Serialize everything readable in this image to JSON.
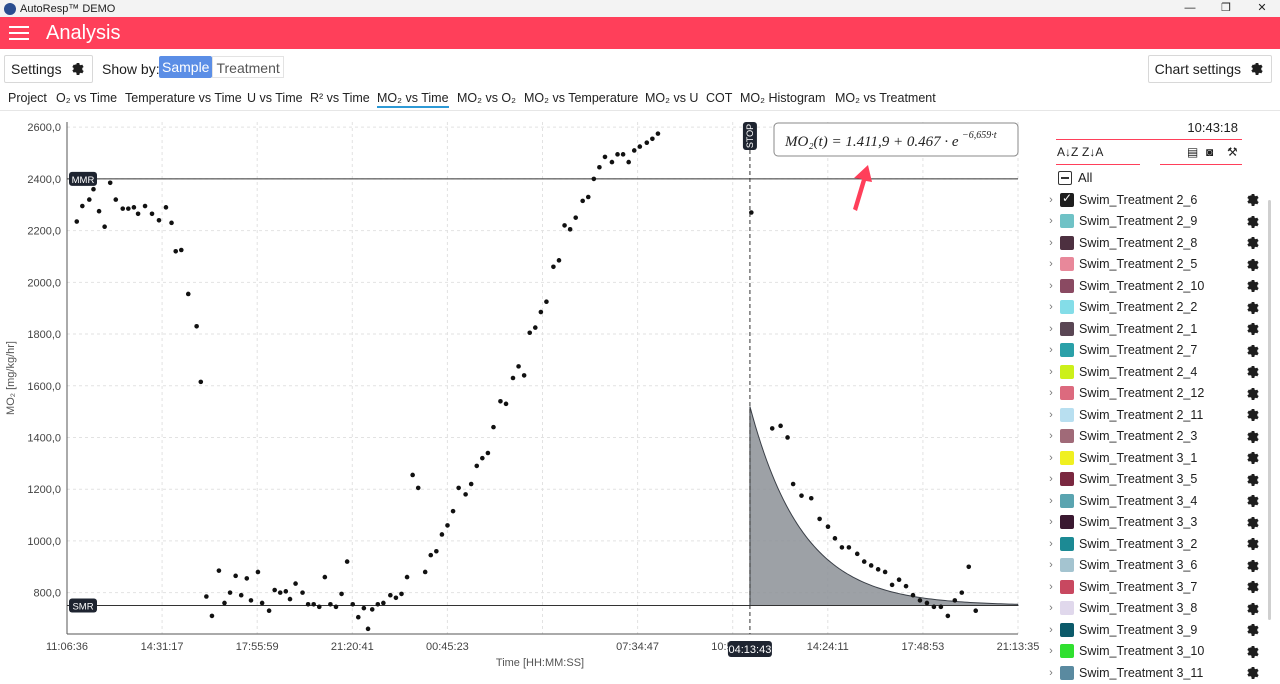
{
  "window": {
    "title": "AutoResp™ DEMO",
    "minimize": "—",
    "maximize": "❐",
    "close": "✕"
  },
  "header": {
    "title": "Analysis"
  },
  "toolbar": {
    "settings_label": "Settings",
    "showby_label": "Show by:",
    "sample_label": "Sample",
    "treatment_label": "Treatment",
    "chart_settings_label": "Chart settings"
  },
  "tabs": [
    "Project",
    "O₂ vs Time",
    "Temperature vs Time",
    "U vs Time",
    "R² vs Time",
    "MO₂ vs Time",
    "MO₂ vs O₂",
    "MO₂ vs Temperature",
    "MO₂ vs U",
    "COT",
    "MO₂ Histogram",
    "MO₂ vs Treatment"
  ],
  "active_tab": 5,
  "sidebar": {
    "time": "10:43:18",
    "all_label": "All",
    "items": [
      {
        "label": "Swim_Treatment 2_6",
        "color": "#1e1e1e",
        "checked": true
      },
      {
        "label": "Swim_Treatment 2_9",
        "color": "#6fc2c6"
      },
      {
        "label": "Swim_Treatment 2_8",
        "color": "#4d3040"
      },
      {
        "label": "Swim_Treatment 2_5",
        "color": "#e8889a"
      },
      {
        "label": "Swim_Treatment 2_10",
        "color": "#8a4a62"
      },
      {
        "label": "Swim_Treatment 2_2",
        "color": "#84dde8"
      },
      {
        "label": "Swim_Treatment 2_1",
        "color": "#5a4654"
      },
      {
        "label": "Swim_Treatment 2_7",
        "color": "#2aa0a8"
      },
      {
        "label": "Swim_Treatment 2_4",
        "color": "#ccf01a"
      },
      {
        "label": "Swim_Treatment 2_12",
        "color": "#dc6a7e"
      },
      {
        "label": "Swim_Treatment 2_11",
        "color": "#b8dff0"
      },
      {
        "label": "Swim_Treatment 2_3",
        "color": "#a06a78"
      },
      {
        "label": "Swim_Treatment 3_1",
        "color": "#f0f020"
      },
      {
        "label": "Swim_Treatment 3_5",
        "color": "#7a2840"
      },
      {
        "label": "Swim_Treatment 3_4",
        "color": "#5aa4b0"
      },
      {
        "label": "Swim_Treatment 3_3",
        "color": "#3a1830"
      },
      {
        "label": "Swim_Treatment 3_2",
        "color": "#1c8a94"
      },
      {
        "label": "Swim_Treatment 3_6",
        "color": "#a4c4d0"
      },
      {
        "label": "Swim_Treatment 3_7",
        "color": "#c84860"
      },
      {
        "label": "Swim_Treatment 3_8",
        "color": "#e0d8ec"
      },
      {
        "label": "Swim_Treatment 3_9",
        "color": "#0c5a6a"
      },
      {
        "label": "Swim_Treatment 3_10",
        "color": "#30e030"
      },
      {
        "label": "Swim_Treatment 3_11",
        "color": "#5a8aa0"
      }
    ]
  },
  "chart_data": {
    "type": "scatter",
    "ylabel": "MO₂ [mg/kg/hr]",
    "xlabel": "Time [HH:MM:SS]",
    "ylim": [
      640,
      2620
    ],
    "yticks": [
      800,
      1000,
      1200,
      1400,
      1600,
      1800,
      2000,
      2200,
      2400,
      2600
    ],
    "ytick_labels": [
      "800,0",
      "1000,0",
      "1200,0",
      "1400,0",
      "1600,0",
      "1800,0",
      "2000,0",
      "2200,0",
      "2400,0",
      "2600,0"
    ],
    "xtick_labels": [
      "11:06:36",
      "14:31:17",
      "17:55:59",
      "21:20:41",
      "00:45:23",
      "04:13:43",
      "07:34:47",
      "10:59:29",
      "14:24:11",
      "17:48:53",
      "21:13:35"
    ],
    "xlim_hours": [
      0,
      34.117
    ],
    "mmr": {
      "label": "MMR",
      "value": 2400
    },
    "smr": {
      "label": "SMR",
      "value": 750
    },
    "stop": {
      "label": "STOP",
      "x_hours": 24.5,
      "time_label": "04:13:43"
    },
    "equation": "MO₂(t) = 1.411,9 + 0.467 · e",
    "equation_exponent": "−6,659·t",
    "fit_start": 1520,
    "grid": true,
    "points": [
      [
        0.35,
        2235
      ],
      [
        0.55,
        2295
      ],
      [
        0.8,
        2320
      ],
      [
        0.95,
        2360
      ],
      [
        1.15,
        2275
      ],
      [
        1.35,
        2215
      ],
      [
        1.55,
        2385
      ],
      [
        1.75,
        2320
      ],
      [
        2.0,
        2285
      ],
      [
        2.2,
        2285
      ],
      [
        2.4,
        2290
      ],
      [
        2.55,
        2265
      ],
      [
        2.8,
        2295
      ],
      [
        3.05,
        2265
      ],
      [
        3.3,
        2240
      ],
      [
        3.55,
        2290
      ],
      [
        3.75,
        2230
      ],
      [
        3.9,
        2120
      ],
      [
        4.1,
        2125
      ],
      [
        4.35,
        1955
      ],
      [
        4.65,
        1830
      ],
      [
        4.8,
        1615
      ],
      [
        5.0,
        785
      ],
      [
        5.2,
        710
      ],
      [
        5.45,
        885
      ],
      [
        5.65,
        760
      ],
      [
        5.85,
        800
      ],
      [
        6.05,
        865
      ],
      [
        6.25,
        790
      ],
      [
        6.45,
        855
      ],
      [
        6.6,
        770
      ],
      [
        6.85,
        880
      ],
      [
        7.0,
        760
      ],
      [
        7.25,
        730
      ],
      [
        7.45,
        810
      ],
      [
        7.65,
        800
      ],
      [
        7.85,
        805
      ],
      [
        8.0,
        775
      ],
      [
        8.2,
        835
      ],
      [
        8.45,
        800
      ],
      [
        8.65,
        755
      ],
      [
        8.85,
        755
      ],
      [
        9.05,
        745
      ],
      [
        9.25,
        860
      ],
      [
        9.45,
        755
      ],
      [
        9.65,
        745
      ],
      [
        9.85,
        795
      ],
      [
        10.05,
        920
      ],
      [
        10.25,
        755
      ],
      [
        10.45,
        705
      ],
      [
        10.65,
        740
      ],
      [
        10.8,
        660
      ],
      [
        10.95,
        735
      ],
      [
        11.15,
        755
      ],
      [
        11.35,
        760
      ],
      [
        11.6,
        790
      ],
      [
        11.8,
        780
      ],
      [
        12.0,
        795
      ],
      [
        12.2,
        860
      ],
      [
        12.4,
        1255
      ],
      [
        12.6,
        1205
      ],
      [
        12.85,
        880
      ],
      [
        13.05,
        945
      ],
      [
        13.25,
        960
      ],
      [
        13.45,
        1025
      ],
      [
        13.65,
        1060
      ],
      [
        13.85,
        1115
      ],
      [
        14.05,
        1205
      ],
      [
        14.3,
        1180
      ],
      [
        14.5,
        1220
      ],
      [
        14.7,
        1290
      ],
      [
        14.9,
        1320
      ],
      [
        15.1,
        1340
      ],
      [
        15.3,
        1440
      ],
      [
        15.55,
        1540
      ],
      [
        15.75,
        1530
      ],
      [
        16.0,
        1630
      ],
      [
        16.2,
        1675
      ],
      [
        16.4,
        1640
      ],
      [
        16.6,
        1805
      ],
      [
        16.8,
        1825
      ],
      [
        17.0,
        1885
      ],
      [
        17.2,
        1925
      ],
      [
        17.45,
        2060
      ],
      [
        17.65,
        2085
      ],
      [
        17.85,
        2220
      ],
      [
        18.05,
        2205
      ],
      [
        18.25,
        2250
      ],
      [
        18.5,
        2315
      ],
      [
        18.7,
        2330
      ],
      [
        18.9,
        2400
      ],
      [
        19.1,
        2445
      ],
      [
        19.3,
        2485
      ],
      [
        19.55,
        2465
      ],
      [
        19.75,
        2495
      ],
      [
        19.95,
        2495
      ],
      [
        20.15,
        2465
      ],
      [
        20.35,
        2510
      ],
      [
        20.55,
        2525
      ],
      [
        20.8,
        2540
      ],
      [
        21.0,
        2555
      ],
      [
        21.2,
        2575
      ],
      [
        24.55,
        2270
      ],
      [
        25.3,
        1435
      ],
      [
        25.6,
        1445
      ],
      [
        25.85,
        1400
      ],
      [
        26.05,
        1220
      ],
      [
        26.35,
        1175
      ],
      [
        26.7,
        1165
      ],
      [
        27.0,
        1085
      ],
      [
        27.3,
        1055
      ],
      [
        27.55,
        1010
      ],
      [
        27.8,
        975
      ],
      [
        28.05,
        975
      ],
      [
        28.35,
        950
      ],
      [
        28.6,
        920
      ],
      [
        28.85,
        905
      ],
      [
        29.1,
        890
      ],
      [
        29.35,
        880
      ],
      [
        29.6,
        830
      ],
      [
        29.85,
        850
      ],
      [
        30.1,
        825
      ],
      [
        30.35,
        790
      ],
      [
        30.6,
        770
      ],
      [
        30.85,
        760
      ],
      [
        31.1,
        745
      ],
      [
        31.35,
        745
      ],
      [
        31.6,
        710
      ],
      [
        31.85,
        770
      ],
      [
        32.1,
        800
      ],
      [
        32.35,
        900
      ],
      [
        32.6,
        730
      ]
    ]
  }
}
